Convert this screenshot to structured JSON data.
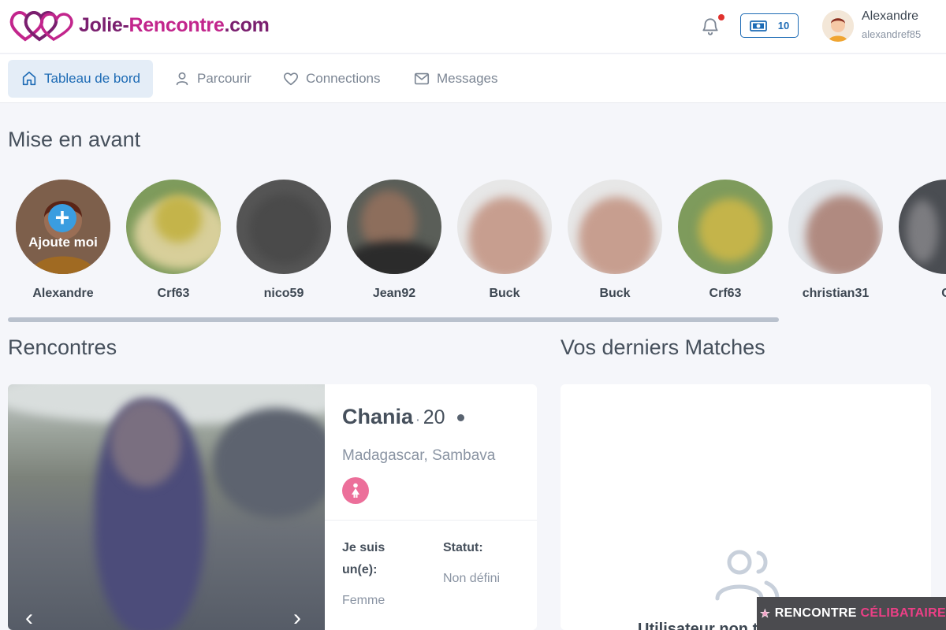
{
  "header": {
    "logo_text": "Jolie-Rencontre.com",
    "logo_parts": [
      "Jolie-",
      "Rencontre",
      ".com"
    ],
    "credits": "10",
    "user_name": "Alexandre",
    "user_handle": "alexandref85",
    "icons": {
      "notifications": "bell-icon",
      "credits": "cash-icon"
    },
    "notification_dot_color": "#e0312d"
  },
  "nav": {
    "items": [
      {
        "label": "Tableau de bord",
        "icon": "home-icon",
        "active": true
      },
      {
        "label": "Parcourir",
        "icon": "user-icon",
        "active": false
      },
      {
        "label": "Connections",
        "icon": "heart-icon",
        "active": false
      },
      {
        "label": "Messages",
        "icon": "mail-icon",
        "active": false
      }
    ]
  },
  "featured": {
    "title": "Mise en avant",
    "add_label": "Ajoute moi",
    "profiles": [
      {
        "name": "Alexandre"
      },
      {
        "name": "Crf63"
      },
      {
        "name": "nico59"
      },
      {
        "name": "Jean92"
      },
      {
        "name": "Buck"
      },
      {
        "name": "Buck"
      },
      {
        "name": "Crf63"
      },
      {
        "name": "christian31"
      },
      {
        "name": "C"
      }
    ]
  },
  "rencontres": {
    "title": "Rencontres",
    "profile": {
      "name": "Chania",
      "age": "20",
      "location": "Madagascar, Sambava",
      "gender_icon": "female-icon",
      "iam_label": "Je suis un(e):",
      "iam_value": "Femme",
      "status_label": "Statut:",
      "status_value": "Non défini"
    }
  },
  "matches": {
    "title": "Vos derniers Matches",
    "empty_text_partial": "Utilisateur non trouvé",
    "icon": "users-icon"
  },
  "watermark": {
    "part1": "RENCONTRE",
    "part2": "CÉLIBATAIRE"
  },
  "colors": {
    "brand_purple": "#7a1f6f",
    "brand_pink": "#c2258c",
    "accent_blue": "#1d6bb5",
    "female_pink": "#ec6f9a"
  }
}
